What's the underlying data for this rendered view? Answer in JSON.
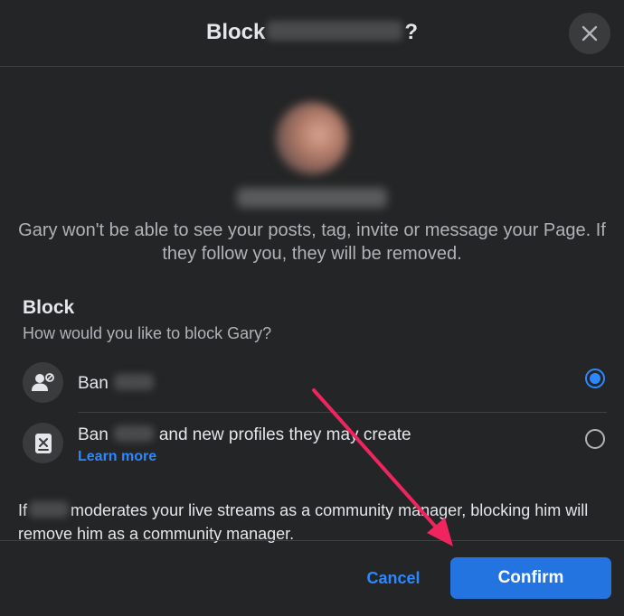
{
  "dialog": {
    "title_prefix": "Block",
    "title_suffix": "?",
    "close_icon": "close-icon"
  },
  "profile": {
    "description": "Gary won't be able to see your posts, tag, invite or message your Page. If they follow you, they will be removed."
  },
  "block_section": {
    "title": "Block",
    "subtitle": "How would you like to block Gary?",
    "options": [
      {
        "icon": "user-ban-icon",
        "label_prefix": "Ban",
        "label_suffix": "",
        "selected": true
      },
      {
        "icon": "profiles-list-icon",
        "label_prefix": "Ban",
        "label_suffix": "and new profiles they may create",
        "link": "Learn more",
        "selected": false
      }
    ]
  },
  "note": {
    "prefix": "If",
    "suffix": "moderates your live streams as a community manager, blocking him will remove him as a community manager."
  },
  "footer": {
    "cancel_label": "Cancel",
    "confirm_label": "Confirm"
  },
  "colors": {
    "background": "#242526",
    "primary": "#2374e1",
    "link": "#2d88ff",
    "annotation_arrow": "#f0245e"
  }
}
